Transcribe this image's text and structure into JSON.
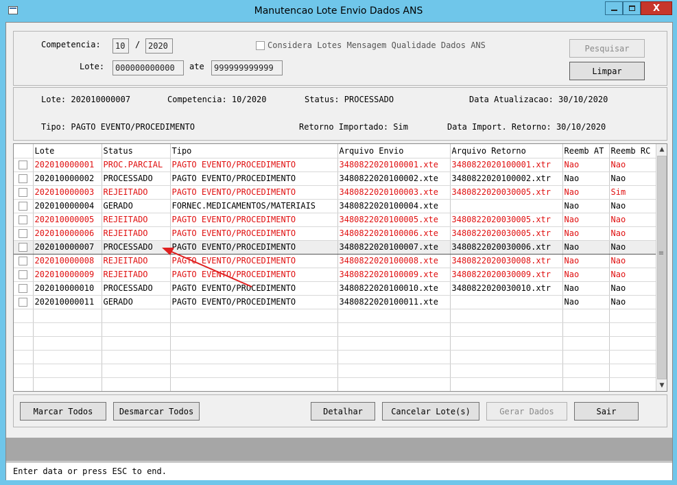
{
  "window": {
    "title": "Manutencao Lote Envio Dados ANS",
    "close_glyph": "X"
  },
  "search": {
    "competencia_label": "Competencia:",
    "competencia_month": "10",
    "competencia_sep": "/",
    "competencia_year": "2020",
    "lote_label": "Lote:",
    "lote_from": "000000000000",
    "ate_label": "ate",
    "lote_to": "999999999999",
    "considera_label": "Considera Lotes Mensagem Qualidade Dados ANS",
    "pesquisar_label": "Pesquisar",
    "limpar_label": "Limpar"
  },
  "details": {
    "lote": "Lote: 202010000007",
    "competencia": "Competencia: 10/2020",
    "status": "Status: PROCESSADO",
    "data_atualizacao": "Data Atualizacao: 30/10/2020",
    "tipo": "Tipo: PAGTO EVENTO/PROCEDIMENTO",
    "retorno_importado": "Retorno Importado: Sim",
    "data_import": "Data Import. Retorno: 30/10/2020"
  },
  "grid": {
    "columns": [
      "",
      "Lote",
      "Status",
      "Tipo",
      "Arquivo Envio",
      "Arquivo Retorno",
      "Reemb AT",
      "Reemb RC"
    ],
    "rows": [
      {
        "lote": "202010000001",
        "status": "PROC.PARCIAL",
        "tipo": "PAGTO EVENTO/PROCEDIMENTO",
        "envio": "3480822020100001.xte",
        "retorno": "3480822020100001.xtr",
        "at": "Nao",
        "rc": "Nao",
        "red": true
      },
      {
        "lote": "202010000002",
        "status": "PROCESSADO",
        "tipo": "PAGTO EVENTO/PROCEDIMENTO",
        "envio": "3480822020100002.xte",
        "retorno": "3480822020100002.xtr",
        "at": "Nao",
        "rc": "Nao",
        "red": false
      },
      {
        "lote": "202010000003",
        "status": "REJEITADO",
        "tipo": "PAGTO EVENTO/PROCEDIMENTO",
        "envio": "3480822020100003.xte",
        "retorno": "3480822020030005.xtr",
        "at": "Nao",
        "rc": "Sim",
        "red": true
      },
      {
        "lote": "202010000004",
        "status": "GERADO",
        "tipo": "FORNEC.MEDICAMENTOS/MATERIAIS",
        "envio": "3480822020100004.xte",
        "retorno": "",
        "at": "Nao",
        "rc": "Nao",
        "red": false
      },
      {
        "lote": "202010000005",
        "status": "REJEITADO",
        "tipo": "PAGTO EVENTO/PROCEDIMENTO",
        "envio": "3480822020100005.xte",
        "retorno": "3480822020030005.xtr",
        "at": "Nao",
        "rc": "Nao",
        "red": true
      },
      {
        "lote": "202010000006",
        "status": "REJEITADO",
        "tipo": "PAGTO EVENTO/PROCEDIMENTO",
        "envio": "3480822020100006.xte",
        "retorno": "3480822020030005.xtr",
        "at": "Nao",
        "rc": "Nao",
        "red": true
      },
      {
        "lote": "202010000007",
        "status": "PROCESSADO",
        "tipo": "PAGTO EVENTO/PROCEDIMENTO",
        "envio": "3480822020100007.xte",
        "retorno": "3480822020030006.xtr",
        "at": "Nao",
        "rc": "Nao",
        "red": false,
        "selected": true
      },
      {
        "lote": "202010000008",
        "status": "REJEITADO",
        "tipo": "PAGTO EVENTO/PROCEDIMENTO",
        "envio": "3480822020100008.xte",
        "retorno": "3480822020030008.xtr",
        "at": "Nao",
        "rc": "Nao",
        "red": true
      },
      {
        "lote": "202010000009",
        "status": "REJEITADO",
        "tipo": "PAGTO EVENTO/PROCEDIMENTO",
        "envio": "3480822020100009.xte",
        "retorno": "3480822020030009.xtr",
        "at": "Nao",
        "rc": "Nao",
        "red": true
      },
      {
        "lote": "202010000010",
        "status": "PROCESSADO",
        "tipo": "PAGTO EVENTO/PROCEDIMENTO",
        "envio": "3480822020100010.xte",
        "retorno": "3480822020030010.xtr",
        "at": "Nao",
        "rc": "Nao",
        "red": false
      },
      {
        "lote": "202010000011",
        "status": "GERADO",
        "tipo": "PAGTO EVENTO/PROCEDIMENTO",
        "envio": "3480822020100011.xte",
        "retorno": "",
        "at": "Nao",
        "rc": "Nao",
        "red": false
      }
    ]
  },
  "buttons": {
    "marcar_todos": "Marcar Todos",
    "desmarcar_todos": "Desmarcar Todos",
    "detalhar": "Detalhar",
    "cancelar_lotes": "Cancelar Lote(s)",
    "gerar_dados": "Gerar Dados",
    "sair": "Sair"
  },
  "statusbar": {
    "text": "Enter data or press ESC to end."
  },
  "colors": {
    "red_text": "#e01010",
    "titlebar": "#6fc6ea",
    "annotation_arrow": "#e02020"
  },
  "icons": {
    "scroll_up": "▲",
    "scroll_down": "▼",
    "scroll_grip": "≡"
  }
}
